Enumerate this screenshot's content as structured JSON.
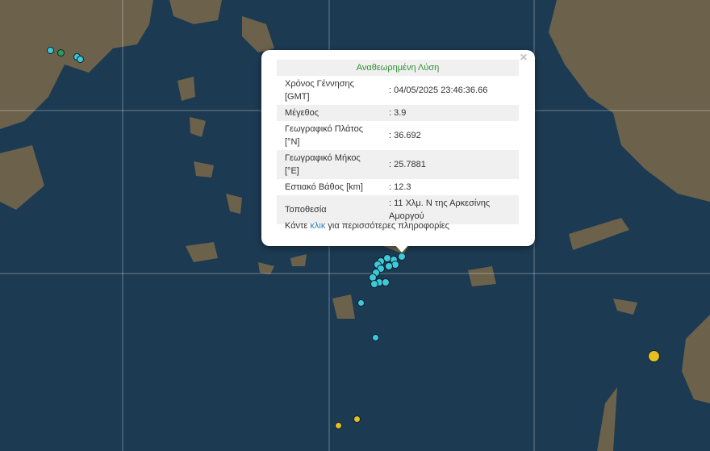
{
  "popup": {
    "title": "Αναθεωρημένη Λύση",
    "close_symbol": "×",
    "rows": [
      {
        "label": "Χρόνος Γέννησης [GMT]",
        "value": ": 04/05/2025 23:46:36.66"
      },
      {
        "label": "Μέγεθος",
        "value": ": 3.9"
      },
      {
        "label": "Γεωγραφικό Πλάτος [°N]",
        "value": ": 36.692"
      },
      {
        "label": "Γεωγραφικό Μήκος [°E]",
        "value": ": 25.7881"
      },
      {
        "label": "Εστιακό Βάθος [km]",
        "value": ": 12.3"
      },
      {
        "label": "Τοποθεσία",
        "value": ": 11 Χλμ. Ν της Αρκεσίνης Αμοργού"
      }
    ],
    "more_prefix": "Κάντε ",
    "more_link": "κλικ",
    "more_suffix": " για περισσότερες πληροφορίες"
  },
  "colors": {
    "sea": "#1c3a52",
    "land": "#7a6a4a",
    "marker_cyan": "#3fc8d6",
    "marker_green": "#2e9c55",
    "marker_yellow": "#e6c021",
    "title_green": "#2f8f2f",
    "link_blue": "#2a7ab8"
  }
}
